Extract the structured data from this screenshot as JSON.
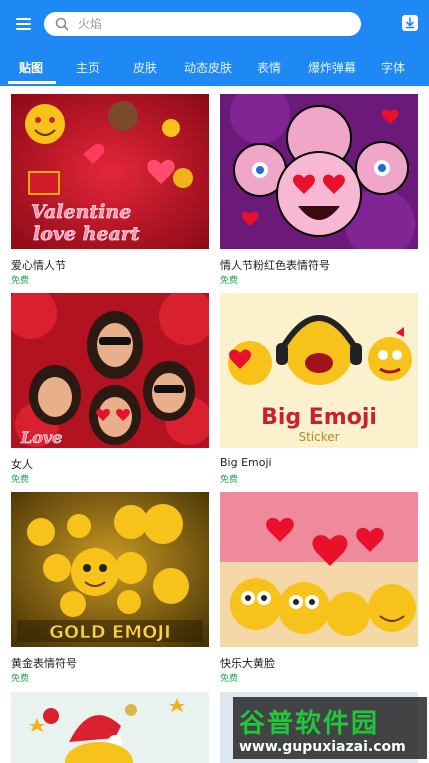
{
  "search": {
    "placeholder": "火焰"
  },
  "tabs": [
    {
      "label": "贴图",
      "active": true
    },
    {
      "label": "主页",
      "active": false
    },
    {
      "label": "皮肤",
      "active": false
    },
    {
      "label": "动态皮肤",
      "active": false
    },
    {
      "label": "表情",
      "active": false
    },
    {
      "label": "爆炸弹幕",
      "active": false
    },
    {
      "label": "字体",
      "active": false
    }
  ],
  "cards": [
    {
      "title": "爱心情人节",
      "price": "免费",
      "art_text": "Valentine love heart"
    },
    {
      "title": "情人节粉红色表情符号",
      "price": "免费",
      "art_text": ""
    },
    {
      "title": "女人",
      "price": "免费",
      "art_text": "Love"
    },
    {
      "title": "Big Emoji",
      "price": "免费",
      "art_text": "Big Emoji",
      "art_sub": "Sticker"
    },
    {
      "title": "黄金表情符号",
      "price": "免费",
      "art_text": "GOLD EMOJI"
    },
    {
      "title": "快乐大黄脸",
      "price": "免费",
      "art_text": ""
    }
  ],
  "watermark": {
    "title": "谷普软件园",
    "url": "www.gupuxiazai.com"
  },
  "colors": {
    "header": "#1e88f5",
    "price": "#23a454"
  }
}
